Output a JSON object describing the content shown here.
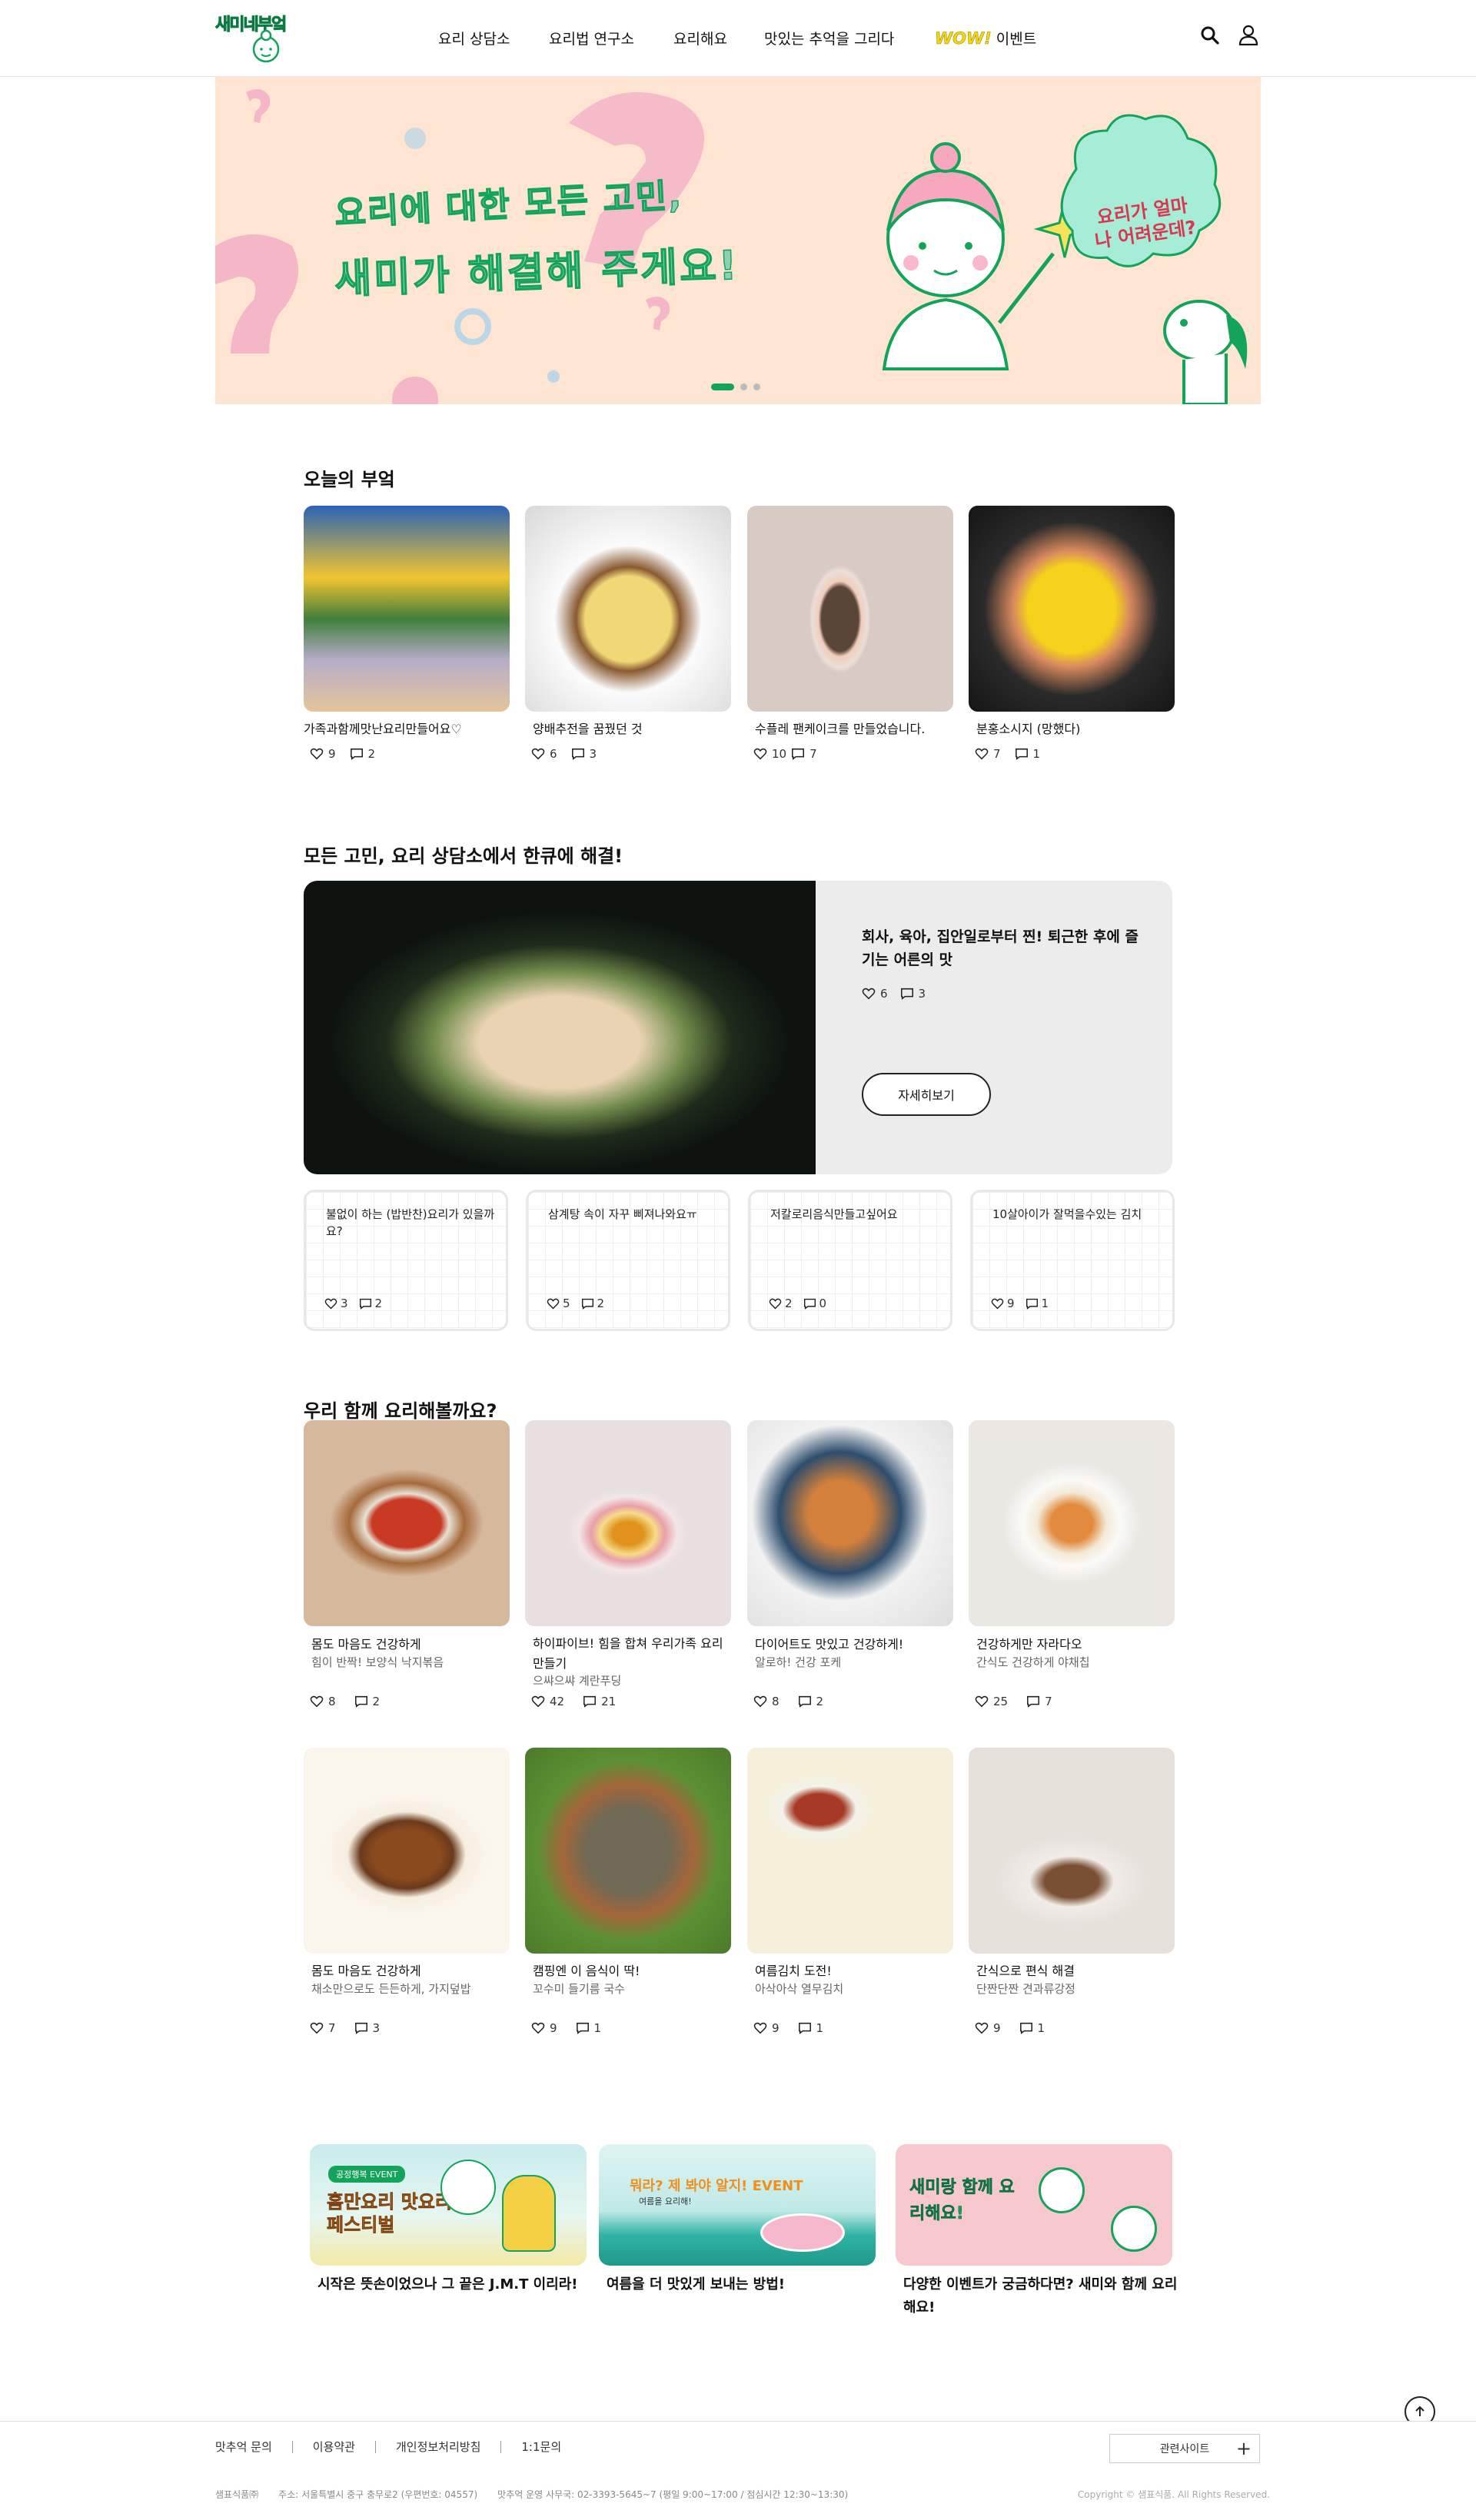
{
  "header": {
    "logo_text": "새미네부엌",
    "nav": [
      "요리 상담소",
      "요리법 연구소",
      "요리해요",
      "맛있는 추억을 그리다",
      "이벤트"
    ],
    "wow_label": "WOW!",
    "colors": {
      "brand_green": "#13a35a",
      "wow_yellow": "#f5d518"
    }
  },
  "hero": {
    "line1": "요리에 대한 모든 고민,",
    "line2": "새미가 해결해 주게요!",
    "bubble": "요리가 얼마나 어려운데?",
    "slide_index": 1,
    "slide_count": 3
  },
  "today": {
    "title": "오늘의 부엌",
    "items": [
      {
        "caption": "가족과함께맛난요리만들어요♡",
        "likes": "9",
        "comments": "2"
      },
      {
        "caption": "양배추전을 꿈꿨던 것",
        "likes": "6",
        "comments": "3"
      },
      {
        "caption": "수플레 팬케이크를 만들었습니다.",
        "likes": "10",
        "comments": "7"
      },
      {
        "caption": "분홍소시지 (망했다)",
        "likes": "7",
        "comments": "1"
      }
    ]
  },
  "consult": {
    "title": "모든 고민, 요리 상담소에서 한큐에 해결!",
    "featured": {
      "title": "회사, 육아, 집안일로부터 찐! 퇴근한 후에 즐기는 어른의 맛",
      "likes": "6",
      "comments": "3",
      "button": "자세히보기"
    },
    "questions": [
      {
        "text": "불없이 하는 (밥반찬)요리가 있을까요?",
        "likes": "3",
        "comments": "2"
      },
      {
        "text": "삼계탕 속이 자꾸 삐져나와요ㅠ",
        "likes": "5",
        "comments": "2"
      },
      {
        "text": "저칼로리음식만들고싶어요",
        "likes": "2",
        "comments": "0"
      },
      {
        "text": "10살아이가 잘먹을수있는 김치",
        "likes": "9",
        "comments": "1"
      }
    ]
  },
  "cook": {
    "title": "우리 함께 요리해볼까요?",
    "items": [
      {
        "title": "몸도 마음도 건강하게",
        "sub": "힘이 반짝! 보양식 낙지볶음",
        "likes": "8",
        "comments": "2"
      },
      {
        "title": "하이파이브! 힘을 합쳐 우리가족 요리 만들기",
        "sub": "으쌰으쌰 계란푸딩",
        "likes": "42",
        "comments": "21"
      },
      {
        "title": "다이어트도 맛있고 건강하게!",
        "sub": "알로하! 건강 포케",
        "likes": "8",
        "comments": "2"
      },
      {
        "title": "건강하게만 자라다오",
        "sub": "간식도 건강하게 야채칩",
        "likes": "25",
        "comments": "7"
      },
      {
        "title": "몸도 마음도 건강하게",
        "sub": "채소만으로도 든든하게, 가지덮밥",
        "likes": "7",
        "comments": "3"
      },
      {
        "title": "캠핑엔 이 음식이 딱!",
        "sub": "꼬수미 들기름 국수",
        "likes": "9",
        "comments": "1"
      },
      {
        "title": "여름김치 도전!",
        "sub": "아삭아삭 열무김치",
        "likes": "9",
        "comments": "1"
      },
      {
        "title": "간식으로 편식 해결",
        "sub": "단짠단짠 견과류강정",
        "likes": "9",
        "comments": "1"
      }
    ]
  },
  "events": [
    {
      "caption": "시작은 뜻손이었으나 그 끝은 J.M.T 이리라!",
      "banner": "홈만요리 맛요리 페스티벌",
      "tag": "공정행복 EVENT"
    },
    {
      "caption": "여름을 더 맛있게 보내는 방법!",
      "banner": "뭐라? 제 봐야 알지! EVENT",
      "tag": "여름을 요리해!"
    },
    {
      "caption": "다양한 이벤트가 궁금하다면? 새미와 함께 요리해요!",
      "banner": "새미랑 함께 요리해요!"
    }
  ],
  "footer": {
    "links": [
      "맛추억 문의",
      "이용약관",
      "개인정보처리방침",
      "1:1문의"
    ],
    "related": "관련사이트",
    "company": "샘표식품㈜",
    "address": "주소: 서울특별시 중구 충무로2 (우편번호: 04557)",
    "office": "맛추억 운영 사무국: 02-3393-5645~7 (평일 9:00~17:00 / 점심시간 12:30~13:30)",
    "copyright": "Copyright © 샘표식품. All Rights Reserved."
  }
}
